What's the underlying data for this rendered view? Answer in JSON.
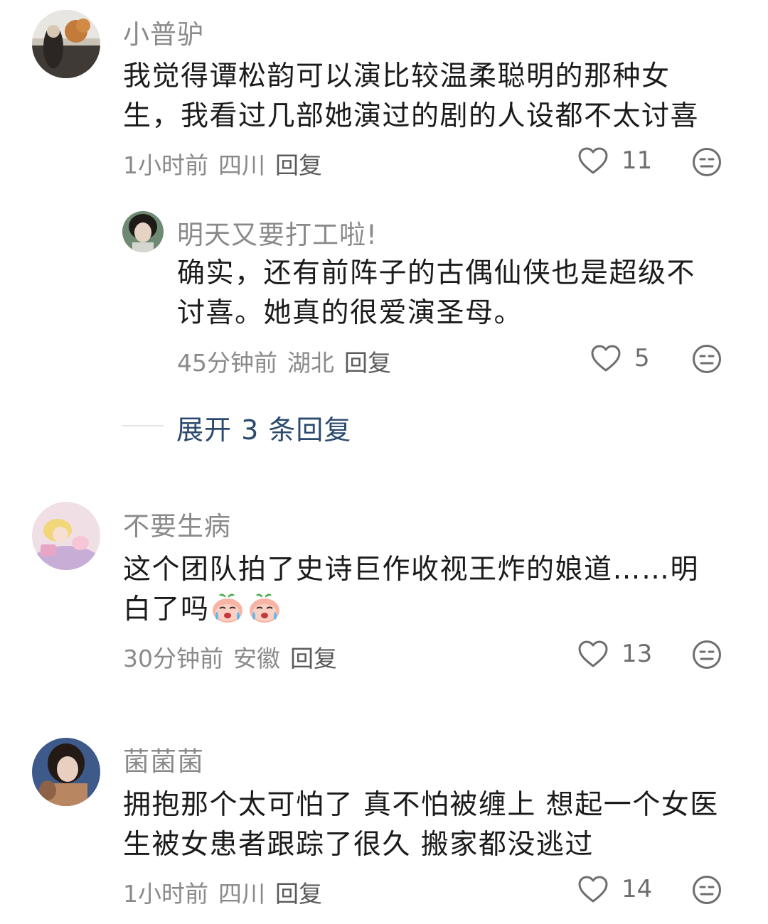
{
  "comments": [
    {
      "username": "小普驴",
      "text_lines": [
        "我觉得谭松韵可以演比较温柔聪明的那种女",
        "生，我看过几部她演过的剧的人设都不太讨喜"
      ],
      "time": "1小时前",
      "location": "四川",
      "reply_label": "回复",
      "likes": "11",
      "avatar_icon": "photo-avatar-autumn-tree"
    },
    {
      "username": "明天又要打工啦!",
      "text_lines": [
        "确实，还有前阵子的古偶仙侠也是超级不",
        "讨喜。她真的很爱演圣母。"
      ],
      "time": "45分钟前",
      "location": "湖北",
      "reply_label": "回复",
      "likes": "5",
      "avatar_icon": "photo-avatar-girl"
    },
    {
      "username": "不要生病",
      "text_lines": [
        "这个团队拍了史诗巨作收视王炸的娘道……明",
        "白了吗"
      ],
      "time": "30分钟前",
      "location": "安徽",
      "reply_label": "回复",
      "likes": "13",
      "avatar_icon": "photo-avatar-anime",
      "inline_emojis": [
        "crying-peach-emoji",
        "crying-peach-emoji"
      ]
    },
    {
      "username": "菌菌菌",
      "text_lines": [
        "拥抱那个太可怕了 真不怕被缠上 想起一个女医",
        "生被女患者跟踪了很久 搬家都没逃过"
      ],
      "time": "1小时前",
      "location": "四川",
      "reply_label": "回复",
      "likes": "14",
      "avatar_icon": "photo-avatar-woman"
    }
  ],
  "expand_replies": {
    "label": "展开 3 条回复"
  },
  "icons": {
    "like": "heart-outline-icon",
    "reaction": "neutral-face-icon"
  },
  "colors": {
    "username": "#8a8a8a",
    "text": "#1b1b1b",
    "meta": "#8a8a8a",
    "expand": "#2c4a6e"
  }
}
